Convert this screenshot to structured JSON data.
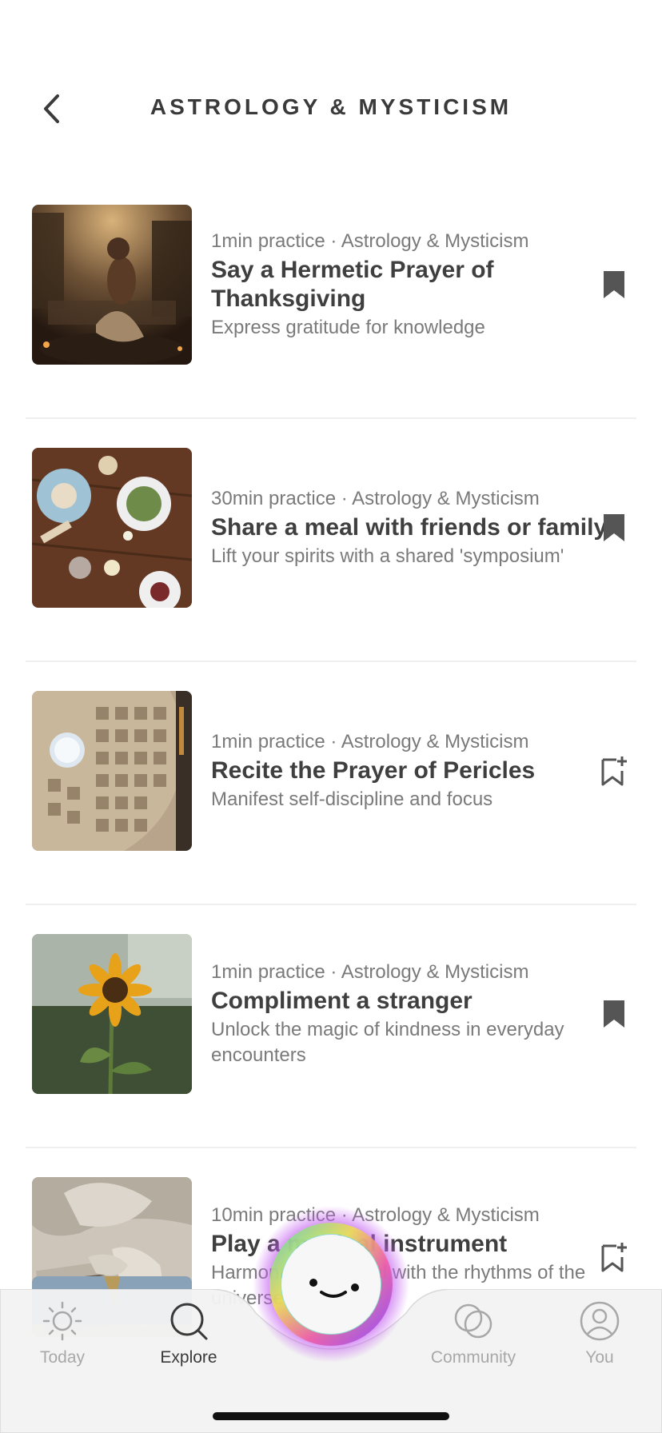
{
  "header": {
    "title": "ASTROLOGY & MYSTICISM"
  },
  "practices": [
    {
      "meta": "1min practice · Astrology & Mysticism",
      "title": "Say a Hermetic Prayer of Thanksgiving",
      "subtitle": "Express gratitude for knowledge",
      "bookmarked": true,
      "image": "woman-in-ancient-ruins"
    },
    {
      "meta": "30min practice · Astrology & Mysticism",
      "title": "Share a meal with friends or family",
      "subtitle": "Lift your spirits with a shared 'symposium'",
      "bookmarked": true,
      "image": "shared-meal-table"
    },
    {
      "meta": "1min practice · Astrology & Mysticism",
      "title": "Recite the Prayer of Pericles",
      "subtitle": "Manifest self-discipline and focus",
      "bookmarked": false,
      "image": "pantheon-dome"
    },
    {
      "meta": "1min practice · Astrology & Mysticism",
      "title": "Compliment a stranger",
      "subtitle": "Unlock the magic of kindness in everyday encounters",
      "bookmarked": true,
      "image": "sunflower"
    },
    {
      "meta": "10min practice · Astrology & Mysticism",
      "title": "Play a musical instrument",
      "subtitle": "Harmonize your soul with the rhythms of the universe",
      "bookmarked": false,
      "image": "marble-lyre-statue"
    }
  ],
  "tabbar": {
    "tabs": [
      {
        "label": "Today",
        "icon": "sun-icon",
        "active": false
      },
      {
        "label": "Explore",
        "icon": "search-icon",
        "active": true
      },
      {
        "label": "Community",
        "icon": "overlapping-circles-icon",
        "active": false
      },
      {
        "label": "You",
        "icon": "person-icon",
        "active": false
      }
    ]
  },
  "colors": {
    "text": "#3f3f3f",
    "muted": "#7a7a7a",
    "tab_inactive": "#a8a8a8",
    "bookmark": "#555555"
  }
}
